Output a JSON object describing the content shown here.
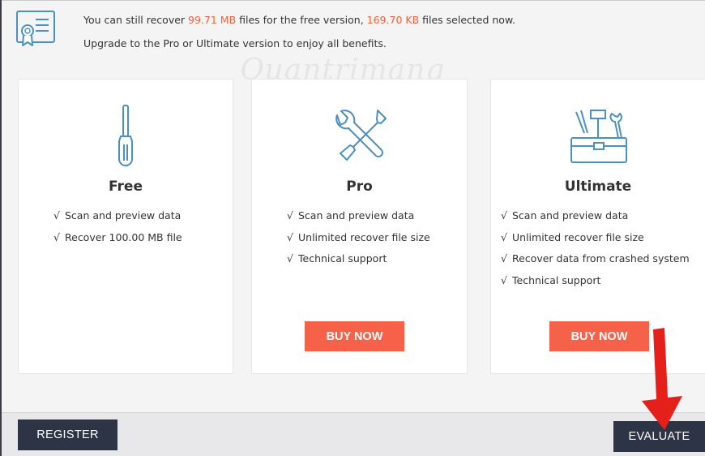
{
  "header": {
    "line1_prefix": "You can still recover ",
    "recover_amount": "99.71 MB",
    "line1_middle": " files for the free version, ",
    "selected_amount": "169.70 KB",
    "line1_suffix": " files selected now.",
    "line2": "Upgrade to the Pro or Ultimate version to enjoy all benefits."
  },
  "watermark": "Quantrimang",
  "plans": [
    {
      "name": "Free",
      "icon": "screwdriver-icon",
      "features": [
        "Scan and preview data",
        "Recover  100.00 MB file"
      ]
    },
    {
      "name": "Pro",
      "icon": "wrench-screwdriver-icon",
      "features": [
        "Scan and preview data",
        "Unlimited recover file size",
        "Technical support"
      ],
      "button": "BUY NOW"
    },
    {
      "name": "Ultimate",
      "icon": "toolbox-icon",
      "features": [
        "Scan and preview data",
        "Unlimited recover file size",
        "Recover data from crashed system",
        "Technical support"
      ],
      "button": "BUY NOW"
    }
  ],
  "check_mark": "√",
  "footer": {
    "register_label": "REGISTER",
    "evaluate_label": "EVALUATE"
  },
  "colors": {
    "highlight": "#f4623a",
    "buy_button": "#f66249",
    "dark_button": "#2c3446",
    "arrow": "#e5201b"
  }
}
